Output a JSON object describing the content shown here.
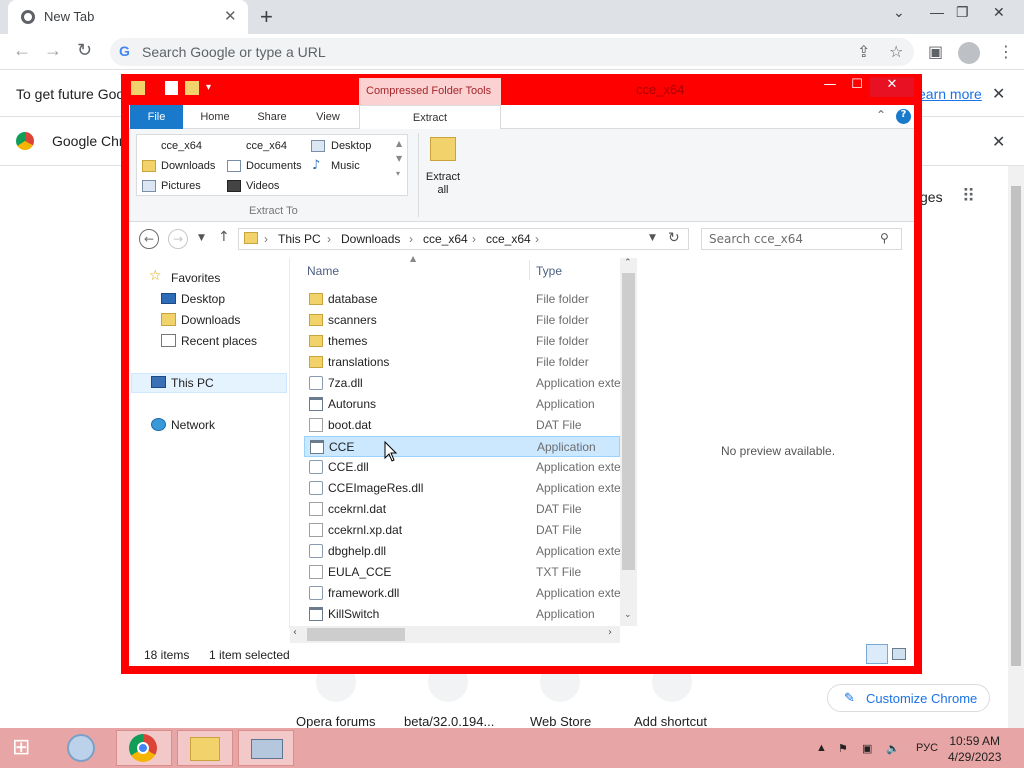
{
  "browser": {
    "tab_title": "New Tab",
    "tab_close": "✕",
    "new_tab": "+",
    "minimize": "⌄",
    "omnibox_placeholder": "Search Google or type a URL",
    "infobar_text": "To get future Goog",
    "infobar_link": "earn more",
    "infobar2_text": "Google Chro",
    "ntp_apps_partial": "ges",
    "shortcuts": [
      "Opera forums",
      "beta/32.0.194...",
      "Web Store",
      "Add shortcut"
    ],
    "customize": "Customize Chrome"
  },
  "explorer": {
    "title": "cce_x64",
    "context_tab": "Compressed Folder Tools",
    "tabs": [
      "File",
      "Home",
      "Share",
      "View",
      "Extract"
    ],
    "gallery": [
      {
        "label": "cce_x64",
        "icon": "folder-icon"
      },
      {
        "label": "cce_x64",
        "icon": "folder-icon"
      },
      {
        "label": "Desktop",
        "icon": "desktop-icon"
      },
      {
        "label": "Downloads",
        "icon": "downloads-icon"
      },
      {
        "label": "Documents",
        "icon": "documents-icon"
      },
      {
        "label": "Music",
        "icon": "music-icon"
      },
      {
        "label": "Pictures",
        "icon": "pictures-icon"
      },
      {
        "label": "Videos",
        "icon": "videos-icon"
      }
    ],
    "extract_to": "Extract To",
    "extract_all": "Extract all",
    "breadcrumb": [
      "This PC",
      "Downloads",
      "cce_x64",
      "cce_x64"
    ],
    "search_placeholder": "Search cce_x64",
    "nav": {
      "favorites": "Favorites",
      "desktop": "Desktop",
      "downloads": "Downloads",
      "recent": "Recent places",
      "thispc": "This PC",
      "network": "Network"
    },
    "columns": {
      "name": "Name",
      "type": "Type"
    },
    "files": [
      {
        "name": "database",
        "type": "File folder",
        "kind": "folder"
      },
      {
        "name": "scanners",
        "type": "File folder",
        "kind": "folder"
      },
      {
        "name": "themes",
        "type": "File folder",
        "kind": "folder"
      },
      {
        "name": "translations",
        "type": "File folder",
        "kind": "folder"
      },
      {
        "name": "7za.dll",
        "type": "Application exte",
        "kind": "dll"
      },
      {
        "name": "Autoruns",
        "type": "Application",
        "kind": "app"
      },
      {
        "name": "boot.dat",
        "type": "DAT File",
        "kind": "doc"
      },
      {
        "name": "CCE",
        "type": "Application",
        "kind": "app",
        "selected": true
      },
      {
        "name": "CCE.dll",
        "type": "Application exte",
        "kind": "dll"
      },
      {
        "name": "CCEImageRes.dll",
        "type": "Application exte",
        "kind": "dll"
      },
      {
        "name": "ccekrnl.dat",
        "type": "DAT File",
        "kind": "doc"
      },
      {
        "name": "ccekrnl.xp.dat",
        "type": "DAT File",
        "kind": "doc"
      },
      {
        "name": "dbghelp.dll",
        "type": "Application exte",
        "kind": "dll"
      },
      {
        "name": "EULA_CCE",
        "type": "TXT File",
        "kind": "doc"
      },
      {
        "name": "framework.dll",
        "type": "Application exte",
        "kind": "dll"
      },
      {
        "name": "KillSwitch",
        "type": "Application",
        "kind": "app"
      }
    ],
    "preview": "No preview available.",
    "status_items": "18 items",
    "status_selected": "1 item selected"
  },
  "taskbar": {
    "lang": "РУС",
    "time": "10:59 AM",
    "date": "4/29/2023"
  }
}
